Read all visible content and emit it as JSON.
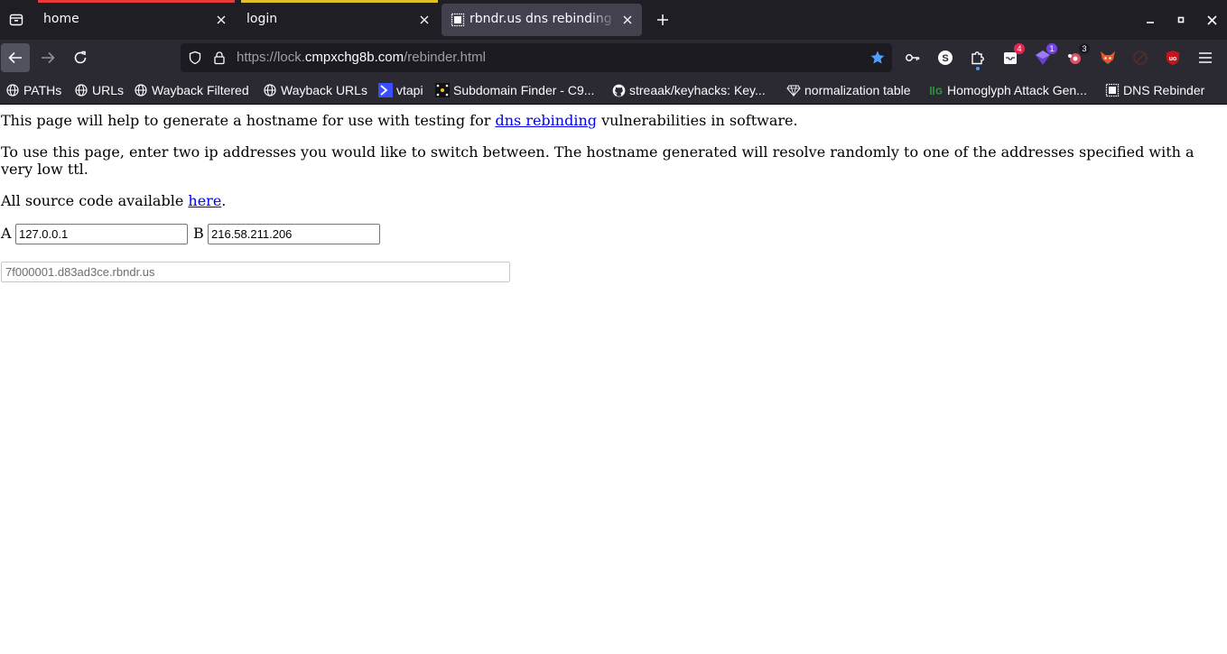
{
  "tabs": [
    {
      "title": "home",
      "accent": "#e93b3b"
    },
    {
      "title": "login",
      "accent": "#e0c228"
    },
    {
      "title": "rbndr.us dns rebinding service",
      "accent": ""
    }
  ],
  "url": {
    "prefix": "https://lock.",
    "host": "cmpxchg8b.com",
    "path": "/rebinder.html"
  },
  "extensions": {
    "badge_1": "4",
    "badge_2": "1",
    "badge_3": "3"
  },
  "bookmarks": [
    {
      "label": "PATHs"
    },
    {
      "label": "URLs"
    },
    {
      "label": "Wayback Filtered"
    },
    {
      "label": "Wayback URLs"
    },
    {
      "label": "vtapi"
    },
    {
      "label": "Subdomain Finder - C9..."
    },
    {
      "label": "streaak/keyhacks: Key..."
    },
    {
      "label": "normalization table"
    },
    {
      "label": "Homoglyph Attack Gen..."
    },
    {
      "label": "DNS Rebinder"
    }
  ],
  "page": {
    "intro_before": "This page will help to generate a hostname for use with testing for ",
    "intro_link": "dns rebinding",
    "intro_after": " vulnerabilities in software.",
    "instructions": "To use this page, enter two ip addresses you would like to switch between. The hostname generated will resolve randomly to one of the addresses specified with a very low ttl.",
    "source_before": "All source code available ",
    "source_link": "here",
    "source_after": ".",
    "label_a": "A",
    "ip_a": "127.0.0.1",
    "label_b": "B",
    "ip_b": "216.58.211.206",
    "hostname": "7f000001.d83ad3ce.rbndr.us"
  }
}
